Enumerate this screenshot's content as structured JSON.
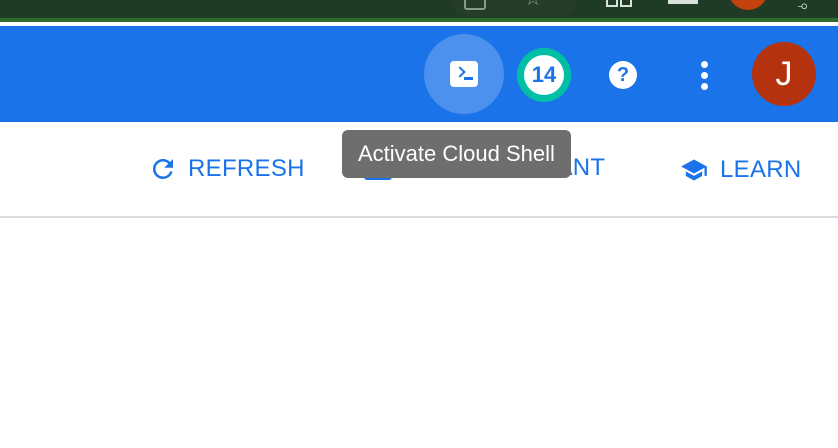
{
  "header": {
    "notification_count": "14",
    "help_glyph": "?",
    "avatar_initial": "J",
    "icons": {
      "cloud_shell": "terminal-icon",
      "notifications": "notification-badge",
      "help": "help-icon",
      "more": "more-vert-icon"
    },
    "colors": {
      "header_bg": "#1a73e8",
      "notification_ring": "#00bfa5",
      "avatar_bg": "#b5320f"
    }
  },
  "toolbar": {
    "refresh_label": "REFRESH",
    "assistant_label": "HELP ASSISTANT",
    "learn_label": "LEARN",
    "icons": {
      "refresh": "refresh-icon",
      "assistant": "chat-icon",
      "learn": "school-icon"
    }
  },
  "tooltip": {
    "text": "Activate Cloud Shell"
  },
  "colors": {
    "accent": "#1a73e8",
    "tooltip_bg": "#6e6e6e",
    "divider": "#dadce0"
  }
}
